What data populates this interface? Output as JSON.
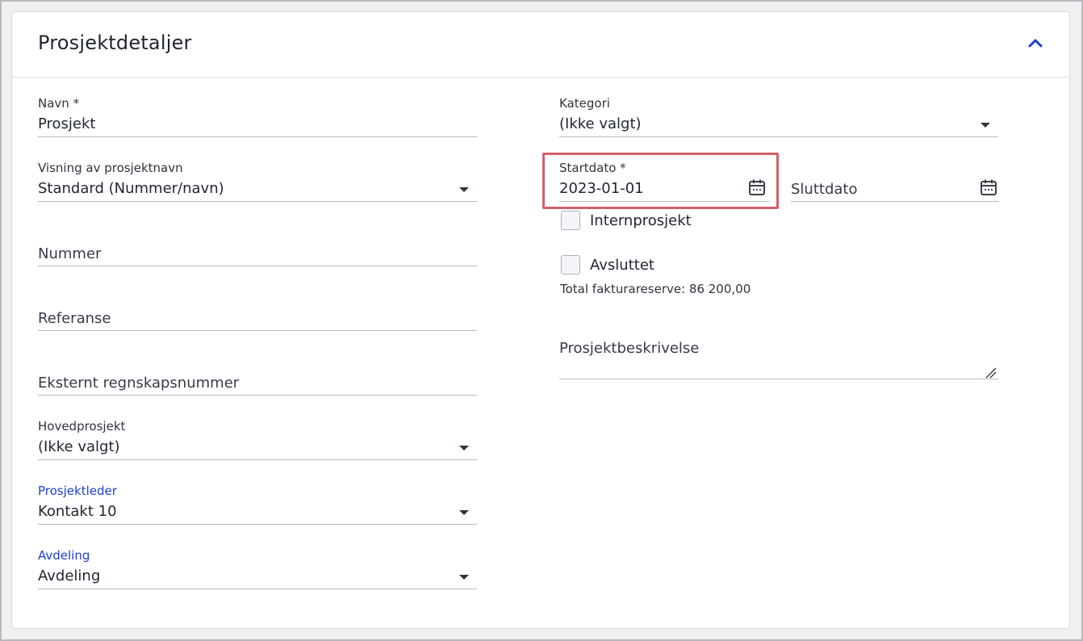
{
  "card": {
    "title": "Prosjektdetaljer",
    "collapse_icon": "chevron-up-icon"
  },
  "left": {
    "navn": {
      "label": "Navn *",
      "value": "Prosjekt"
    },
    "visning": {
      "label": "Visning av prosjektnavn",
      "value": "Standard (Nummer/navn)"
    },
    "nummer": {
      "label": "Nummer"
    },
    "referanse": {
      "label": "Referanse"
    },
    "eksternt": {
      "label": "Eksternt regnskapsnummer"
    },
    "hovedprosjekt": {
      "label": "Hovedprosjekt",
      "value": "(Ikke valgt)"
    },
    "prosjektleder": {
      "label": "Prosjektleder",
      "value": "Kontakt 10"
    },
    "avdeling": {
      "label": "Avdeling",
      "value": "Avdeling"
    }
  },
  "right": {
    "kategori": {
      "label": "Kategori",
      "value": "(Ikke valgt)"
    },
    "startdato": {
      "label": "Startdato *",
      "value": "2023-01-01"
    },
    "sluttdato": {
      "label": "Sluttdato"
    },
    "internprosjekt": {
      "label": "Internprosjekt",
      "checked": false
    },
    "avsluttet": {
      "label": "Avsluttet",
      "checked": false
    },
    "fakturareserve": "Total fakturareserve: 86 200,00",
    "beskrivelse": {
      "label": "Prosjektbeskrivelse"
    }
  },
  "colors": {
    "accent": "#1d3fd1",
    "highlight": "#d4606a"
  }
}
